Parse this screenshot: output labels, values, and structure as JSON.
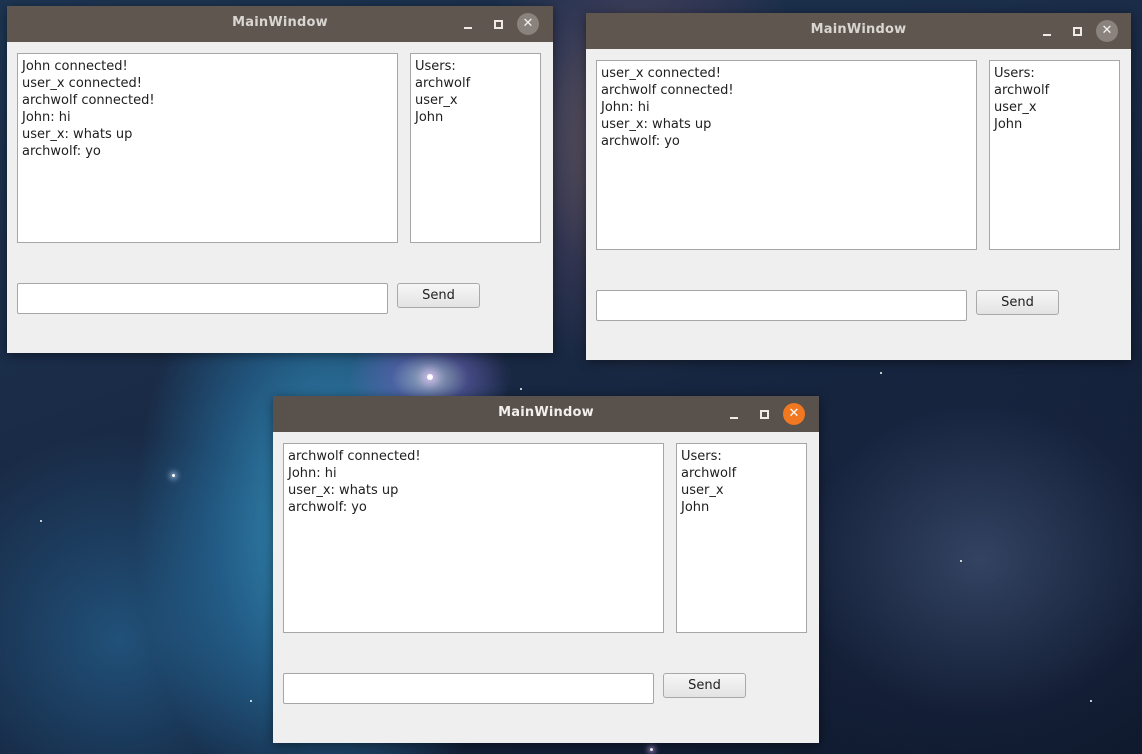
{
  "desktop": {
    "wallpaper": "space nebula"
  },
  "windows": [
    {
      "title": "MainWindow",
      "focused": false,
      "chat_lines": [
        "John connected!",
        "user_x connected!",
        "archwolf connected!",
        "John: hi",
        "user_x: whats up",
        "archwolf: yo"
      ],
      "users": [
        "Users:",
        "archwolf",
        "user_x",
        "John"
      ],
      "input_value": "",
      "send_label": "Send",
      "close_glyph": "✕"
    },
    {
      "title": "MainWindow",
      "focused": false,
      "chat_lines": [
        "user_x connected!",
        "archwolf connected!",
        "John: hi",
        "user_x: whats up",
        "archwolf: yo"
      ],
      "users": [
        "Users:",
        "archwolf",
        "user_x",
        "John"
      ],
      "input_value": "",
      "send_label": "Send",
      "close_glyph": "✕"
    },
    {
      "title": "MainWindow",
      "focused": true,
      "chat_lines": [
        "archwolf connected!",
        "John: hi",
        "user_x: whats up",
        "archwolf: yo"
      ],
      "users": [
        "Users:",
        "archwolf",
        "user_x",
        "John"
      ],
      "input_value": "",
      "send_label": "Send",
      "close_glyph": "✕"
    }
  ],
  "colors": {
    "titlebar": "#5e564f",
    "close_active": "#f07820",
    "close_inactive": "#8a837d",
    "window_bg": "#efefef"
  },
  "icons": {
    "minimize": "minimize-icon",
    "maximize": "maximize-icon",
    "close": "close-icon"
  }
}
